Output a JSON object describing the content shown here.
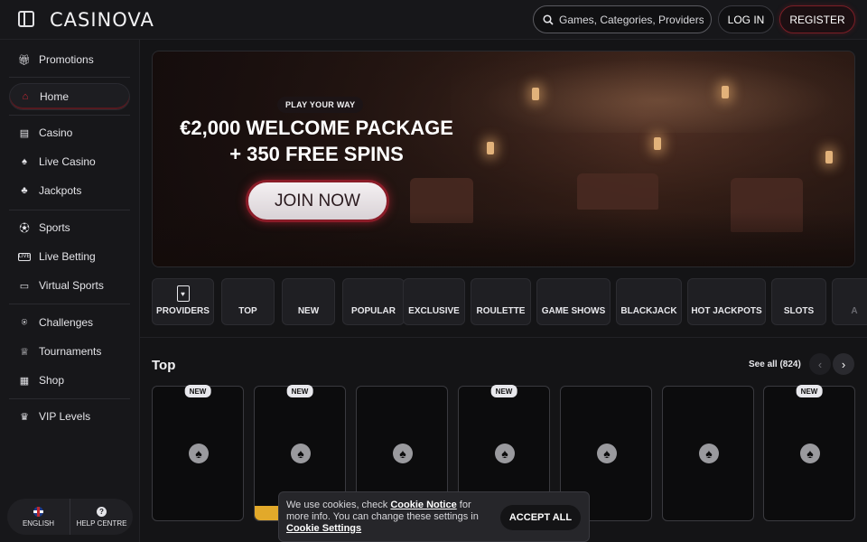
{
  "header": {
    "logo": "CASINOVA",
    "search_placeholder": "Games, Categories, Providers",
    "login_label": "LOG IN",
    "register_label": "REGISTER"
  },
  "sidebar": {
    "items": [
      {
        "label": "Promotions",
        "icon": "gift-icon"
      },
      {
        "label": "Home",
        "icon": "home-icon"
      },
      {
        "label": "Casino",
        "icon": "slot-machine-icon"
      },
      {
        "label": "Live Casino",
        "icon": "dealer-icon"
      },
      {
        "label": "Jackpots",
        "icon": "clover-icon"
      },
      {
        "label": "Sports",
        "icon": "soccer-ball-icon"
      },
      {
        "label": "Live Betting",
        "icon": "live-icon"
      },
      {
        "label": "Virtual Sports",
        "icon": "monitor-icon"
      },
      {
        "label": "Challenges",
        "icon": "medal-icon"
      },
      {
        "label": "Tournaments",
        "icon": "trophy-icon"
      },
      {
        "label": "Shop",
        "icon": "shop-icon"
      },
      {
        "label": "VIP Levels",
        "icon": "crown-icon"
      }
    ],
    "active": "Home",
    "language_label": "ENGLISH",
    "help_label": "HELP CENTRE"
  },
  "hero": {
    "tag": "PLAY YOUR WAY",
    "title_line1": "€2,000 WELCOME PACKAGE",
    "title_line2": "+ 350 FREE SPINS",
    "cta": "JOIN NOW"
  },
  "categories": [
    "PROVIDERS",
    "TOP",
    "NEW",
    "POPULAR",
    "EXCLUSIVE",
    "ROULETTE",
    "GAME SHOWS",
    "BLACKJACK",
    "HOT JACKPOTS",
    "SLOTS",
    "A"
  ],
  "section": {
    "title": "Top",
    "see_all": "See all (824)"
  },
  "games": [
    {
      "badge": "NEW"
    },
    {
      "badge": "NEW"
    },
    {
      "badge": ""
    },
    {
      "badge": "NEW"
    },
    {
      "badge": ""
    },
    {
      "badge": ""
    },
    {
      "badge": "NEW"
    }
  ],
  "cookie": {
    "text_pre": "We use cookies, check ",
    "notice_link": "Cookie Notice",
    "text_mid": " for more info. You can change these settings in ",
    "settings_link": "Cookie Settings",
    "accept": "ACCEPT ALL"
  },
  "colors": {
    "accent_red": "#d42a36",
    "background": "#141416",
    "panel": "#17171a"
  }
}
